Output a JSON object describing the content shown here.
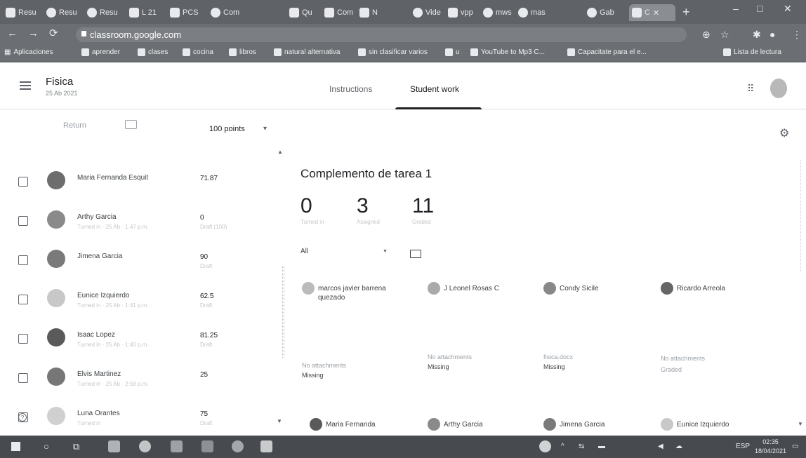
{
  "browser": {
    "tabs": [
      {
        "label": "Resu",
        "icon": "tab-icon"
      },
      {
        "label": "Resu",
        "icon": "tab-icon"
      },
      {
        "label": "Resu",
        "icon": "tab-icon"
      },
      {
        "label": "L 21",
        "icon": "doc-icon"
      },
      {
        "label": "PCS",
        "icon": "doc-icon"
      },
      {
        "label": "Com",
        "icon": "globe-icon"
      },
      {
        "label": "Qu",
        "icon": "tab-icon"
      },
      {
        "label": "Com",
        "icon": "tab-icon"
      },
      {
        "label": "N",
        "icon": "doc-icon"
      },
      {
        "label": "Vide",
        "icon": "globe-icon"
      },
      {
        "label": "vpp",
        "icon": "image-icon"
      },
      {
        "label": "mws",
        "icon": "globe-icon"
      },
      {
        "label": "mas",
        "icon": "globe-icon"
      },
      {
        "label": "Gab",
        "icon": "globe-icon"
      },
      {
        "label": "C",
        "icon": "classroom-icon",
        "active": true
      }
    ],
    "url": "classroom.google.com",
    "bookmarks": [
      "Aplicaciones",
      "aprender",
      "clases",
      "cocina",
      "libros",
      "natural alternativa",
      "sin clasificar varios",
      "u",
      "YouTube to Mp3 C...",
      "Capacitate para el e...",
      "Lista de lectura"
    ]
  },
  "header": {
    "class_name": "Fisica",
    "class_sub": "25 Ab 2021",
    "tabs": [
      "Instructions",
      "Student work"
    ],
    "active_tab": "Student work"
  },
  "toolbar": {
    "return_label": "Return",
    "points_label": "100 points"
  },
  "students": [
    {
      "name": "Maria Fernanda Esquit",
      "sub": "",
      "grade": "71.87",
      "grade_sub": ""
    },
    {
      "name": "Arthy Garcia",
      "sub": "Turned in · 25 Ab · 1.47 p.m.",
      "grade": "0",
      "grade_sub": "Draft (100)"
    },
    {
      "name": "Jimena Garcia",
      "sub": "",
      "grade": "90",
      "grade_sub": "Draft"
    },
    {
      "name": "Eunice Izquierdo",
      "sub": "Turned in · 25 Ab · 1:41 p.m.",
      "grade": "62.5",
      "grade_sub": "Draft"
    },
    {
      "name": "Isaac Lopez",
      "sub": "Turned in · 25 Ab · 1:40 p.m.",
      "grade": "81.25",
      "grade_sub": "Draft"
    },
    {
      "name": "Elvis Martinez",
      "sub": "Turned in · 25 Ab · 2:58 p.m.",
      "grade": "25",
      "grade_sub": ""
    },
    {
      "name": "Luna Orantes",
      "sub": "Turned in",
      "grade": "75",
      "grade_sub": "Draft"
    }
  ],
  "assignment": {
    "title": "Complemento de tarea 1",
    "stats": [
      {
        "value": "0",
        "label": "Turned in"
      },
      {
        "value": "3",
        "label": "Assigned"
      },
      {
        "value": "11",
        "label": "Graded"
      }
    ],
    "filter": "All"
  },
  "cards": [
    {
      "name": "marcos javier barrena quezado",
      "file": "No attachments",
      "status": "Missing"
    },
    {
      "name": "J Leonel Rosas C",
      "file": "No attachments",
      "status": "Missing"
    },
    {
      "name": "Condy Sicile",
      "file": "fisica.docx",
      "status": "Missing"
    },
    {
      "name": "Ricardo Arreola",
      "file": "No attachments",
      "status": "Graded"
    },
    {
      "name": "Maria Fernanda",
      "file": "",
      "status": ""
    },
    {
      "name": "Arthy Garcia",
      "file": "",
      "status": ""
    },
    {
      "name": "Jimena Garcia",
      "file": "",
      "status": ""
    },
    {
      "name": "Eunice Izquierdo",
      "file": "",
      "status": ""
    }
  ],
  "taskbar": {
    "language": "ESP",
    "time": "02:35",
    "date": "18/04/2021"
  }
}
